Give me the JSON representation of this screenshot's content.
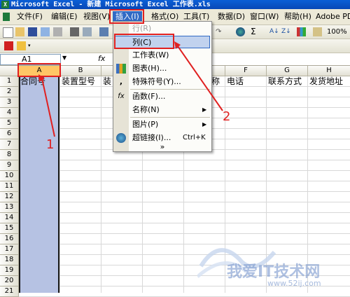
{
  "window": {
    "title": "Microsoft Excel - 新建 Microsoft Excel 工作表.xls",
    "app_icon": "X"
  },
  "menubar": [
    {
      "label": "文件(F)"
    },
    {
      "label": "编辑(E)"
    },
    {
      "label": "视图(V)"
    },
    {
      "label": "插入(I)"
    },
    {
      "label": "格式(O)"
    },
    {
      "label": "工具(T)"
    },
    {
      "label": "数据(D)"
    },
    {
      "label": "窗口(W)"
    },
    {
      "label": "帮助(H)"
    },
    {
      "label": "Adobe PDF"
    }
  ],
  "toolbar": {
    "zoom": "100%"
  },
  "formula_bar": {
    "name_box": "A1",
    "fx": "fx"
  },
  "insert_menu": {
    "items": [
      {
        "label": "行(R)",
        "disabled": true,
        "icon": "",
        "has_submenu": false
      },
      {
        "label": "列(C)",
        "disabled": false,
        "icon": "",
        "has_submenu": false,
        "highlighted": true
      },
      {
        "label": "工作表(W)",
        "disabled": false,
        "icon": "",
        "has_submenu": false
      },
      {
        "label": "图表(H)...",
        "disabled": false,
        "icon": "chart-icon",
        "has_submenu": false
      },
      {
        "label": "特殊符号(Y)...",
        "disabled": false,
        "icon": "comma-icon",
        "has_submenu": false
      },
      {
        "label": "函数(F)...",
        "disabled": false,
        "icon": "fx-icon",
        "has_submenu": false
      },
      {
        "label": "名称(N)",
        "disabled": false,
        "icon": "",
        "has_submenu": true
      },
      {
        "label": "图片(P)",
        "disabled": false,
        "icon": "",
        "has_submenu": true
      },
      {
        "label": "超链接(I)...",
        "disabled": false,
        "icon": "globe-icon",
        "shortcut": "Ctrl+K",
        "has_submenu": false
      }
    ],
    "more": "»"
  },
  "grid": {
    "columns": [
      "A",
      "B",
      "C",
      "D",
      "E",
      "F",
      "G",
      "H"
    ],
    "rows": [
      "1",
      "2",
      "3",
      "4",
      "5",
      "6",
      "7",
      "8",
      "9",
      "10",
      "11",
      "12",
      "13",
      "14",
      "15",
      "16",
      "17",
      "18",
      "19",
      "20",
      "21"
    ],
    "row1": {
      "A": "合同号",
      "B": "装置型号",
      "C": "装",
      "E": "称",
      "F": "电话",
      "G": "联系方式",
      "H": "发货地址"
    }
  },
  "annotations": [
    {
      "label": "1"
    },
    {
      "label": "2"
    }
  ],
  "watermark": {
    "text": "我爱IT技术网",
    "url": "www.52ij.com"
  },
  "colors": {
    "title_bar": "#0848b6",
    "selection": "#b6c2e3",
    "highlight": "#316ac5",
    "annotation": "#e02020"
  }
}
